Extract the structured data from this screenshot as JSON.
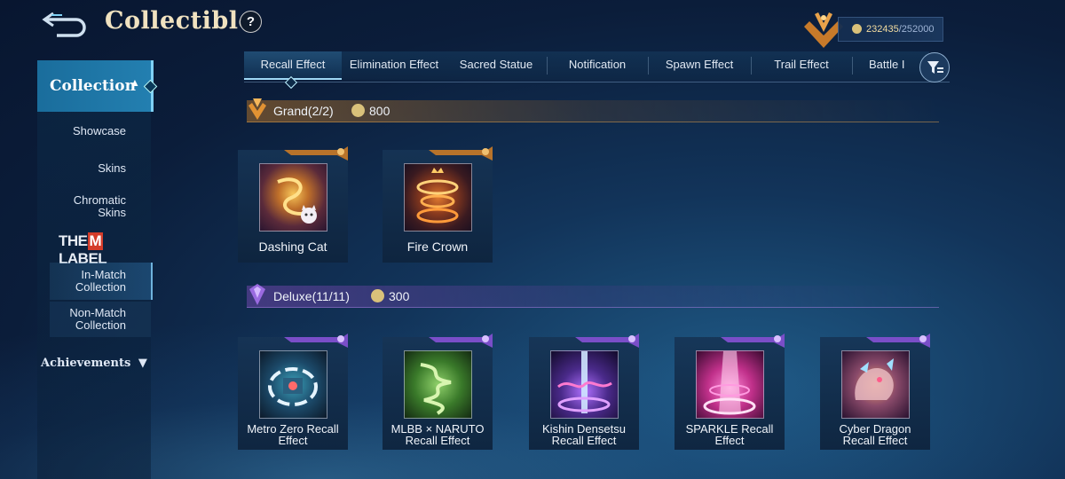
{
  "header": {
    "title": "Collectible",
    "help_label": "?",
    "points_current": "232435",
    "points_total": "/252000"
  },
  "sidebar": {
    "collection_label": "Collection",
    "showcase_label": "Showcase",
    "skins_label": "Skins",
    "chromatic_label_1": "Chromatic",
    "chromatic_label_2": "Skins",
    "mlabel_left": "THE",
    "mlabel_m": "M",
    "mlabel_right": "LABEL",
    "inmatch_label_1": "In-Match",
    "inmatch_label_2": "Collection",
    "nonmatch_label_1": "Non-Match",
    "nonmatch_label_2": "Collection",
    "achievements_label": "Achievements"
  },
  "tabs": [
    {
      "label": "Recall Effect",
      "active": true
    },
    {
      "label": "Elimination Effect"
    },
    {
      "label": "Sacred Statue"
    },
    {
      "label": "Notification"
    },
    {
      "label": "Spawn Effect"
    },
    {
      "label": "Trail Effect"
    },
    {
      "label": "Battle I"
    }
  ],
  "sections": {
    "grand": {
      "name": "Grand(2/2)",
      "price": "800",
      "color": "#d9962f",
      "items": [
        {
          "label": "Dashing Cat",
          "icon": "dashing-cat-thumbnail"
        },
        {
          "label": "Fire Crown",
          "icon": "fire-crown-thumbnail"
        }
      ]
    },
    "deluxe": {
      "name": "Deluxe(11/11)",
      "price": "300",
      "color": "#8a5fd0",
      "items": [
        {
          "label_1": "Metro Zero Recall",
          "label_2": "Effect",
          "icon": "metro-zero-thumbnail"
        },
        {
          "label_1": "MLBB × NARUTO",
          "label_2": "Recall Effect",
          "icon": "naruto-thumbnail"
        },
        {
          "label_1": "Kishin Densetsu",
          "label_2": "Recall Effect",
          "icon": "kishin-densetsu-thumbnail"
        },
        {
          "label_1": "SPARKLE Recall",
          "label_2": "Effect",
          "icon": "sparkle-thumbnail"
        },
        {
          "label_1": "Cyber Dragon",
          "label_2": "Recall Effect",
          "icon": "cyber-dragon-thumbnail"
        }
      ]
    }
  },
  "colors": {
    "accent": "#7fd1f5",
    "coin": "#d9c17a",
    "title": "#f0e2c0"
  }
}
